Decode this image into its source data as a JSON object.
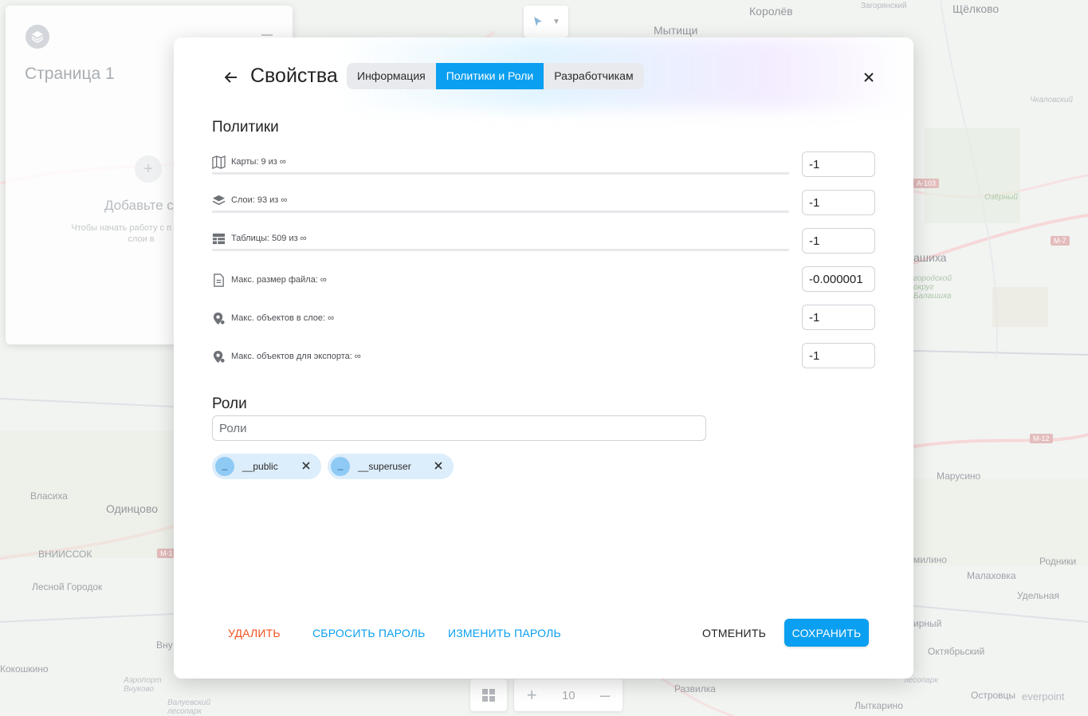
{
  "map": {
    "labels": [
      {
        "text": "Королёв",
        "cls": "big"
      },
      {
        "text": "Загорянский",
        "cls": "small"
      },
      {
        "text": "Щёлково",
        "cls": "big"
      },
      {
        "text": "Мытищи",
        "cls": "big"
      },
      {
        "text": "Чкаловский",
        "cls": "it"
      },
      {
        "text": "Озёрный",
        "cls": "green"
      },
      {
        "text": "ашиха",
        "cls": "big"
      },
      {
        "text": "городской округ Балашиха",
        "cls": "green"
      },
      {
        "text": "Марусино",
        "cls": ""
      },
      {
        "text": "Власиха",
        "cls": ""
      },
      {
        "text": "Одинцово",
        "cls": "big"
      },
      {
        "text": "ВНИИССОК",
        "cls": ""
      },
      {
        "text": "Лесной Городок",
        "cls": ""
      },
      {
        "text": "Вну",
        "cls": ""
      },
      {
        "text": "Кокошкино",
        "cls": ""
      },
      {
        "text": "Аэропорт Внуково",
        "cls": "it"
      },
      {
        "text": "Валуевский лесопарк",
        "cls": "it"
      },
      {
        "text": "Развилка",
        "cls": ""
      },
      {
        "text": "Лыткарино",
        "cls": ""
      },
      {
        "text": "Островцы",
        "cls": ""
      },
      {
        "text": "Родники",
        "cls": ""
      },
      {
        "text": "Малаховка",
        "cls": ""
      },
      {
        "text": "Удельная",
        "cls": ""
      },
      {
        "text": "Октябрьский",
        "cls": ""
      },
      {
        "text": "лесопарк",
        "cls": "it"
      },
      {
        "text": "милино",
        "cls": ""
      },
      {
        "text": "ирный",
        "cls": ""
      }
    ],
    "badges": [
      "А-103",
      "М-7",
      "М-12",
      "М-1"
    ]
  },
  "left_panel": {
    "title": "Страница 1",
    "add_text": "Добавьте сл",
    "hint_text": "Чтобы начать работу с п добавьте слои в"
  },
  "bottom": {
    "zoom": "10",
    "plus": "+",
    "minus": "–",
    "brand": "everpoint"
  },
  "modal": {
    "title": "Свойства",
    "tabs": [
      {
        "label": "Информация",
        "active": false
      },
      {
        "label": "Политики и Роли",
        "active": true
      },
      {
        "label": "Разработчикам",
        "active": false
      }
    ],
    "policies_title": "Политики",
    "policies": [
      {
        "icon": "map-icon",
        "label": "Карты: 9 из ∞",
        "value": "-1",
        "bar": true
      },
      {
        "icon": "layers-icon",
        "label": "Слои: 93 из ∞",
        "value": "-1",
        "bar": true
      },
      {
        "icon": "table-icon",
        "label": "Таблицы: 509 из ∞",
        "value": "-1",
        "bar": true
      },
      {
        "icon": "file-icon",
        "label": "Макс. размер файла: ∞",
        "value": "-0.000001",
        "bar": false
      },
      {
        "icon": "location-icon",
        "label": "Макс. объектов в слое: ∞",
        "value": "-1",
        "bar": false
      },
      {
        "icon": "location-icon",
        "label": "Макс. объектов для экспорта: ∞",
        "value": "-1",
        "bar": false
      }
    ],
    "roles_title": "Роли",
    "roles_placeholder": "Роли",
    "role_chips": [
      {
        "avatar": "_",
        "label": "__public"
      },
      {
        "avatar": "_",
        "label": "__superuser"
      }
    ],
    "buttons": {
      "delete": "УДАЛИТЬ",
      "reset_password": "СБРОСИТЬ ПАРОЛЬ",
      "change_password": "ИЗМЕНИТЬ ПАРОЛЬ",
      "cancel": "ОТМЕНИТЬ",
      "save": "СОХРАНИТЬ"
    }
  },
  "colors": {
    "accent": "#0a9ff0",
    "danger": "#f4511e",
    "chip_bg": "#dcedfb",
    "chip_avatar": "#8fcaf5"
  }
}
